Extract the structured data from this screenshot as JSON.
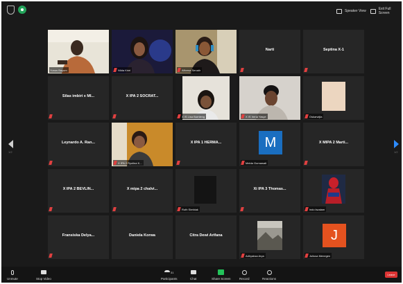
{
  "top_bar": {
    "speaker_view_label": "Speaker View",
    "exit_fullscreen_label": "Exit Full Screen"
  },
  "pagination": {
    "left_page": "1/2",
    "right_page": "1/2"
  },
  "colors": {
    "active_speaker": "#d6e21a",
    "muted": "#e04040",
    "share": "#23c25a",
    "leave": "#dd3333"
  },
  "participants": [
    {
      "name": "Yunus Bayum",
      "video": true,
      "active": true
    },
    {
      "name": "Nilda Kriel",
      "video": true
    },
    {
      "name": "Alfonsa Senatir",
      "video": true
    },
    {
      "name": "Narti",
      "video": false
    },
    {
      "name": "Septina X-1",
      "video": false
    },
    {
      "name": "Silas imbiri x MI...",
      "video": false
    },
    {
      "name": "X IPA 2 SOCRAT...",
      "video": false
    },
    {
      "name": "X IS Lisa Burnleng",
      "video": true
    },
    {
      "name": "X IS Irena Yasye",
      "video": true
    },
    {
      "name": "Oskarwijia",
      "video": true
    },
    {
      "name": "Leynardo A. Ran...",
      "video": false
    },
    {
      "name": "X IPA 2 Ryolina K...",
      "video": true
    },
    {
      "name": "X IPA 1 HERMA...",
      "video": false
    },
    {
      "name": "Melda Gurnawati",
      "avatar_letter": "M"
    },
    {
      "name": "X MIPA 2 Marti...",
      "video": false
    },
    {
      "name": "X IPA 2 BEVLIN...",
      "video": false
    },
    {
      "name": "X mipa 2 chalvi...",
      "video": false
    },
    {
      "name": "Ruth Simbiak",
      "video": true
    },
    {
      "name": "Xi IPA 3 Thomas...",
      "video": false
    },
    {
      "name": "indo kwalam",
      "video": true
    },
    {
      "name": "Fransiska Delya...",
      "video": false
    },
    {
      "name": "Daniela Korwa",
      "video": false
    },
    {
      "name": "Citra Dewi Arifana",
      "video": false
    },
    {
      "name": "Adhyaksa Arya",
      "video": true
    },
    {
      "name": "Juliusa Menegen",
      "avatar_letter": "J"
    }
  ],
  "toolbar": {
    "unmute": "Unmute",
    "stop_video": "Stop Video",
    "participants": "Participants",
    "participant_count": "31",
    "chat": "Chat",
    "share_screen": "Share Screen",
    "record": "Record",
    "reactions": "Reactions",
    "leave": "Leave"
  }
}
